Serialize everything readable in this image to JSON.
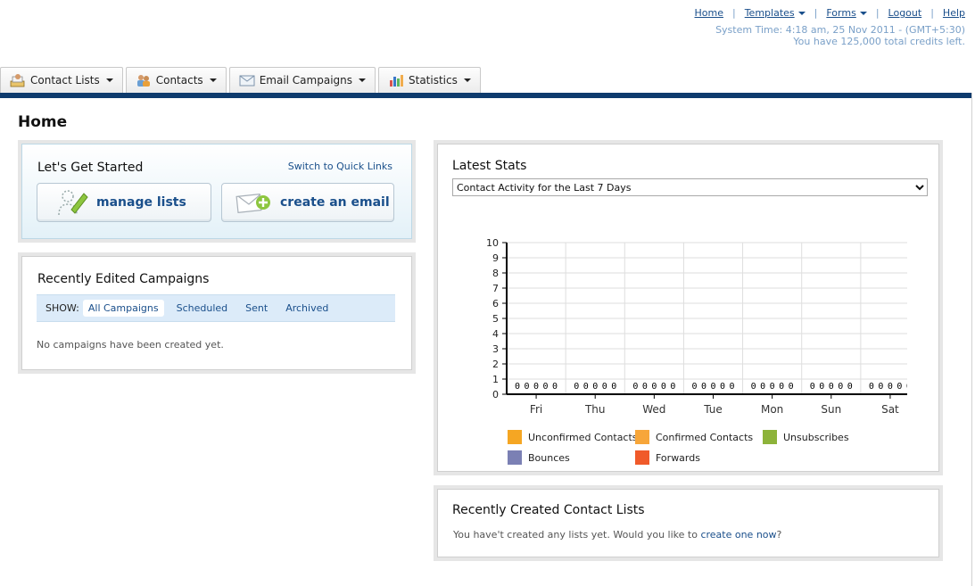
{
  "top_nav": {
    "links": [
      {
        "label": "Home",
        "dropdown": false
      },
      {
        "label": "Templates",
        "dropdown": true
      },
      {
        "label": "Forms",
        "dropdown": true
      },
      {
        "label": "Logout",
        "dropdown": false
      },
      {
        "label": "Help",
        "dropdown": false
      }
    ],
    "system_time": "System Time: 4:18 am, 25 Nov 2011 - (GMT+5:30)",
    "credits": "You have 125,000 total credits left."
  },
  "tabs": [
    {
      "label": "Contact Lists",
      "icon": "contact-lists-icon"
    },
    {
      "label": "Contacts",
      "icon": "contacts-icon"
    },
    {
      "label": "Email Campaigns",
      "icon": "envelope-icon"
    },
    {
      "label": "Statistics",
      "icon": "bar-chart-icon"
    }
  ],
  "page_title": "Home",
  "get_started": {
    "title": "Let's Get Started",
    "quick_links": "Switch to Quick Links",
    "manage_lists": "manage lists",
    "create_email": "create an email"
  },
  "recent_campaigns": {
    "title": "Recently Edited Campaigns",
    "show_label": "SHOW:",
    "filters": [
      "All Campaigns",
      "Scheduled",
      "Sent",
      "Archived"
    ],
    "active_filter": "All Campaigns",
    "empty": "No campaigns have been created yet."
  },
  "latest_stats": {
    "title": "Latest Stats",
    "selected": "Contact Activity for the Last 7 Days"
  },
  "chart_data": {
    "type": "bar",
    "categories": [
      "Fri",
      "Thu",
      "Wed",
      "Tue",
      "Mon",
      "Sun",
      "Sat"
    ],
    "ylim": [
      0,
      10
    ],
    "yticks": [
      0,
      1,
      2,
      3,
      4,
      5,
      6,
      7,
      8,
      9,
      10
    ],
    "grid": true,
    "legend_position": "bottom",
    "series": [
      {
        "name": "Unconfirmed Contacts",
        "color": "#f5a623",
        "values": [
          0,
          0,
          0,
          0,
          0,
          0,
          0
        ]
      },
      {
        "name": "Confirmed Contacts",
        "color": "#f7a63a",
        "values": [
          0,
          0,
          0,
          0,
          0,
          0,
          0
        ]
      },
      {
        "name": "Unsubscribes",
        "color": "#8db33a",
        "values": [
          0,
          0,
          0,
          0,
          0,
          0,
          0
        ]
      },
      {
        "name": "Bounces",
        "color": "#7b80b4",
        "values": [
          0,
          0,
          0,
          0,
          0,
          0,
          0
        ]
      },
      {
        "name": "Forwards",
        "color": "#f05a2a",
        "values": [
          0,
          0,
          0,
          0,
          0,
          0,
          0
        ]
      }
    ]
  },
  "recent_lists": {
    "title": "Recently Created Contact Lists",
    "text": "You have't created any lists yet. Would you like to ",
    "link": "create one now",
    "suffix": "?"
  }
}
